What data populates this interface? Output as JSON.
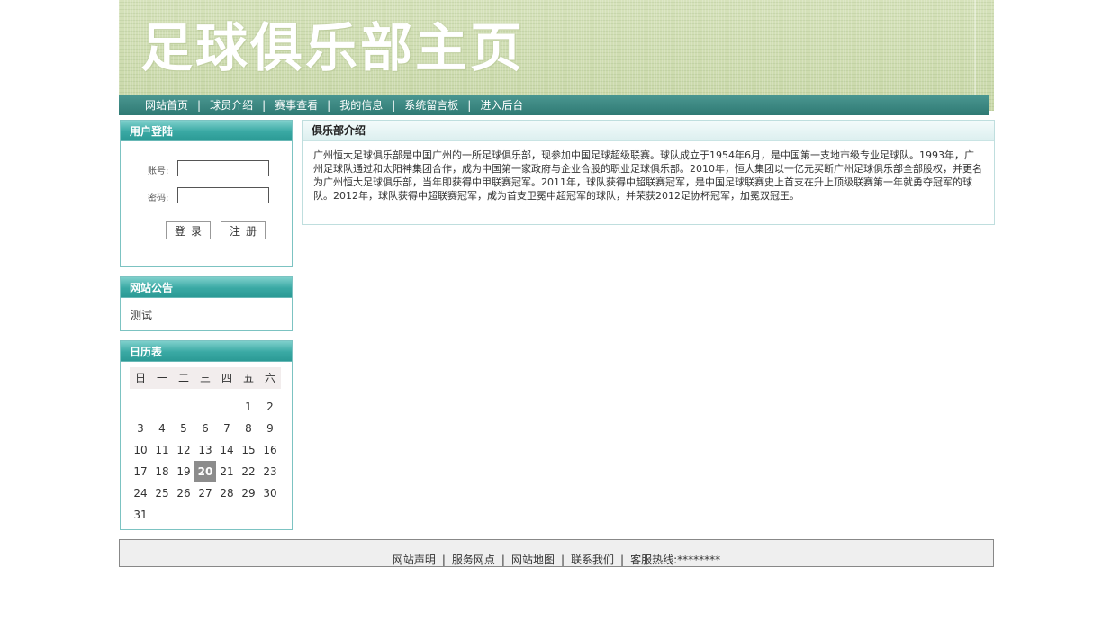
{
  "banner": {
    "title": "足球俱乐部主页"
  },
  "nav": {
    "items": [
      "网站首页",
      "球员介绍",
      "赛事查看",
      "我的信息",
      "系统留言板",
      "进入后台"
    ],
    "separator": "|"
  },
  "login": {
    "title": "用户登陆",
    "account_label": "账号:",
    "password_label": "密码:",
    "account_value": "",
    "password_value": "",
    "login_button": "登录",
    "register_button": "注册"
  },
  "notice": {
    "title": "网站公告",
    "content": "测试"
  },
  "calendar": {
    "title": "日历表",
    "weekdays": [
      "日",
      "一",
      "二",
      "三",
      "四",
      "五",
      "六"
    ],
    "weeks": [
      [
        "",
        "",
        "",
        "",
        "",
        "1",
        "2"
      ],
      [
        "3",
        "4",
        "5",
        "6",
        "7",
        "8",
        "9"
      ],
      [
        "10",
        "11",
        "12",
        "13",
        "14",
        "15",
        "16"
      ],
      [
        "17",
        "18",
        "19",
        "20",
        "21",
        "22",
        "23"
      ],
      [
        "24",
        "25",
        "26",
        "27",
        "28",
        "29",
        "30"
      ],
      [
        "31",
        "",
        "",
        "",
        "",
        "",
        ""
      ]
    ],
    "today": "20"
  },
  "main": {
    "title": "俱乐部介绍",
    "text": "广州恒大足球俱乐部是中国广州的一所足球俱乐部，现参加中国足球超级联赛。球队成立于1954年6月，是中国第一支地市级专业足球队。1993年，广州足球队通过和太阳神集团合作，成为中国第一家政府与企业合股的职业足球俱乐部。2010年，恒大集团以一亿元买断广州足球俱乐部全部股权，并更名为广州恒大足球俱乐部，当年即获得中甲联赛冠军。2011年，球队获得中超联赛冠军，是中国足球联赛史上首支在升上顶级联赛第一年就勇夺冠军的球队。2012年，球队获得中超联赛冠军，成为首支卫冕中超冠军的球队，并荣获2012足协杯冠军，加冕双冠王。"
  },
  "footer": {
    "links": [
      "网站声明",
      "服务网点",
      "网站地图",
      "联系我们"
    ],
    "hotline_label": "客服热线:",
    "hotline_value": "********"
  }
}
